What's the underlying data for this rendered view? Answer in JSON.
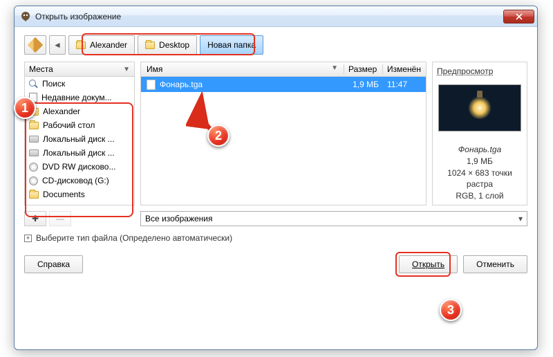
{
  "titlebar": {
    "title": "Открыть изображение"
  },
  "breadcrumb": {
    "items": [
      "Alexander",
      "Desktop",
      "Новая папка"
    ]
  },
  "places": {
    "header": "Места",
    "items": [
      {
        "icon": "search",
        "label": "Поиск"
      },
      {
        "icon": "doc",
        "label": "Недавние докум..."
      },
      {
        "icon": "folder",
        "label": "Alexander"
      },
      {
        "icon": "folder",
        "label": "Рабочий стол"
      },
      {
        "icon": "disk",
        "label": "Локальный диск ..."
      },
      {
        "icon": "disk",
        "label": "Локальный диск ..."
      },
      {
        "icon": "cd",
        "label": "DVD RW дисково..."
      },
      {
        "icon": "cd",
        "label": "CD-дисковод (G:)"
      },
      {
        "icon": "folder",
        "label": "Documents"
      }
    ]
  },
  "files": {
    "cols": {
      "name": "Имя",
      "size": "Размер",
      "mod": "Изменён"
    },
    "rows": [
      {
        "name": "Фонарь.tga",
        "size": "1,9 МБ",
        "mod": "11:47"
      }
    ]
  },
  "preview": {
    "title": "Предпросмотр",
    "filename": "Фонарь.tga",
    "size": "1,9 МБ",
    "dims": "1024 × 683 точки растра",
    "mode": "RGB, 1 слой"
  },
  "filter": {
    "label": "Все изображения"
  },
  "ftype": {
    "label": "Выберите тип файла (Определено автоматически)"
  },
  "buttons": {
    "help": "Справка",
    "open": "Открыть",
    "cancel": "Отменить"
  },
  "badges": {
    "b1": "1",
    "b2": "2",
    "b3": "3"
  }
}
